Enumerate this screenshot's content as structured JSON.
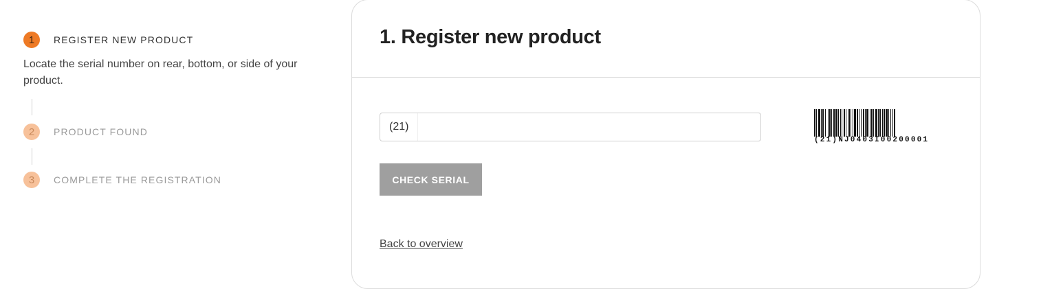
{
  "stepper": {
    "steps": [
      {
        "number": "1",
        "label": "REGISTER NEW PRODUCT",
        "description": "Locate the serial number on rear, bottom, or side of your product."
      },
      {
        "number": "2",
        "label": "PRODUCT FOUND"
      },
      {
        "number": "3",
        "label": "COMPLETE THE REGISTRATION"
      }
    ]
  },
  "card": {
    "title": "1. Register new product",
    "serial_prefix": "(21)",
    "serial_value": "",
    "check_button_label": "CHECK SERIAL",
    "back_link_label": "Back to overview",
    "barcode_text": "(21)NJ0403I00200001"
  },
  "colors": {
    "accent": "#ee7a25",
    "accent_light": "#f7c19a",
    "button_disabled": "#9f9f9f"
  }
}
